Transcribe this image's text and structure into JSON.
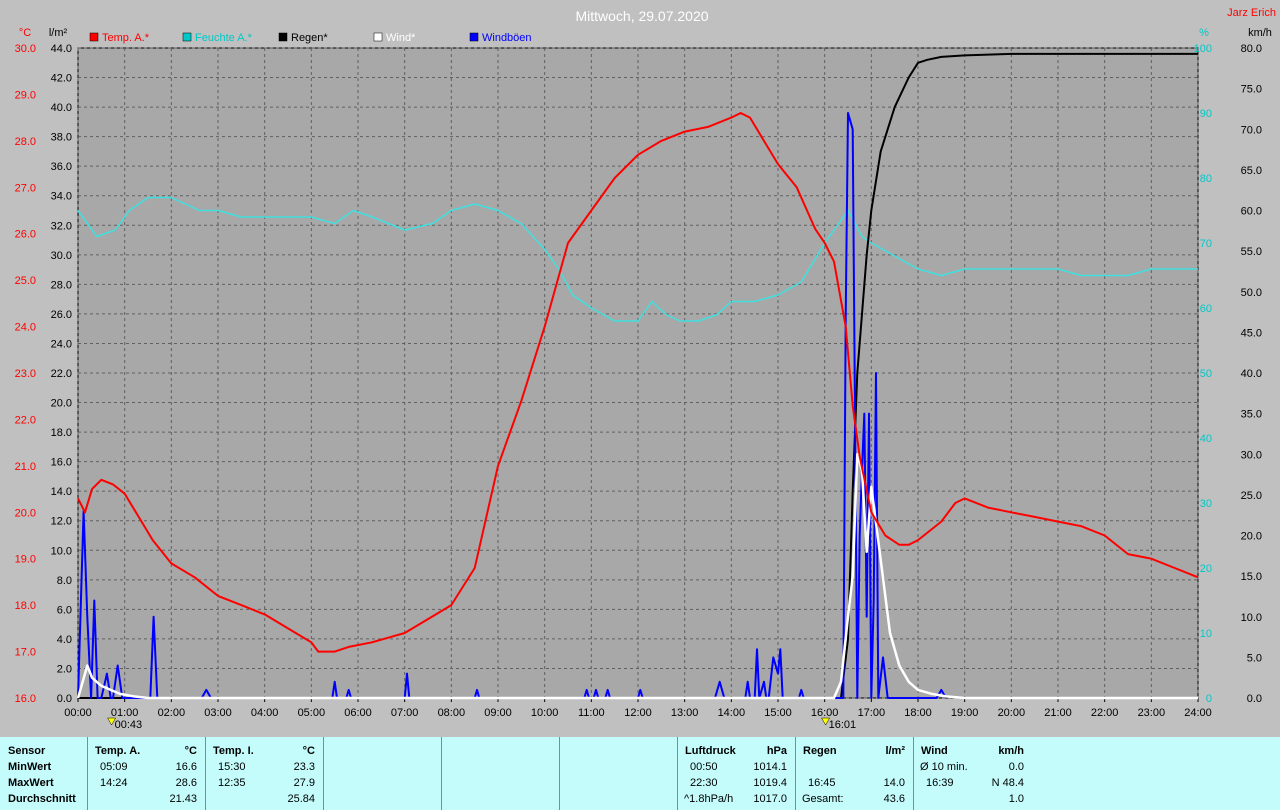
{
  "title": "Mittwoch, 29.07.2020",
  "author": "Jarz Erich",
  "chart_data": {
    "type": "line",
    "title": "Mittwoch, 29.07.2020",
    "legend": [
      {
        "name": "Temp. A.*",
        "color": "#ff0000"
      },
      {
        "name": "Feuchte A.*",
        "color": "#00c8c8"
      },
      {
        "name": "Regen*",
        "color": "#000000"
      },
      {
        "name": "Wind*",
        "color": "#ffffff"
      },
      {
        "name": "Windböen",
        "color": "#0000ff"
      }
    ],
    "colors": {
      "temp": "#ff0000",
      "humidity": "#40e0e0",
      "rain": "#000000",
      "wind": "#ffffff",
      "gust": "#0000ff"
    },
    "x_ticks": [
      "00:00",
      "01:00",
      "02:00",
      "03:00",
      "04:00",
      "05:00",
      "06:00",
      "07:00",
      "08:00",
      "09:00",
      "10:00",
      "11:00",
      "12:00",
      "13:00",
      "14:00",
      "15:00",
      "16:00",
      "17:00",
      "18:00",
      "19:00",
      "20:00",
      "21:00",
      "22:00",
      "23:00",
      "24:00"
    ],
    "x_range": [
      0,
      24
    ],
    "markers": [
      {
        "x": 0.72,
        "label": "00:43"
      },
      {
        "x": 16.02,
        "label": "16:01"
      }
    ],
    "axes": {
      "temp": {
        "unit": "°C",
        "range": [
          16,
          30
        ],
        "ticks": [
          "16.0",
          "17.0",
          "18.0",
          "19.0",
          "20.0",
          "21.0",
          "22.0",
          "23.0",
          "24.0",
          "25.0",
          "26.0",
          "27.0",
          "28.0",
          "29.0",
          "30.0"
        ],
        "color": "#ff0000"
      },
      "rain": {
        "unit": "l/m²",
        "range": [
          0,
          44
        ],
        "ticks": [
          "0.0",
          "2.0",
          "4.0",
          "6.0",
          "8.0",
          "10.0",
          "12.0",
          "14.0",
          "16.0",
          "18.0",
          "20.0",
          "22.0",
          "24.0",
          "26.0",
          "28.0",
          "30.0",
          "32.0",
          "34.0",
          "36.0",
          "38.0",
          "40.0",
          "42.0",
          "44.0"
        ],
        "color": "#000000"
      },
      "humidity": {
        "unit": "%",
        "range": [
          0,
          100
        ],
        "ticks": [
          "0",
          "10",
          "20",
          "30",
          "40",
          "50",
          "60",
          "70",
          "80",
          "90",
          "100"
        ],
        "color": "#00c8c8"
      },
      "wind": {
        "unit": "km/h",
        "range": [
          0,
          80
        ],
        "ticks": [
          "0.0",
          "5.0",
          "10.0",
          "15.0",
          "20.0",
          "25.0",
          "30.0",
          "35.0",
          "40.0",
          "45.0",
          "50.0",
          "55.0",
          "60.0",
          "65.0",
          "70.0",
          "75.0",
          "80.0"
        ],
        "color": "#000000"
      }
    },
    "series": [
      {
        "key": "temp",
        "axis": "temp",
        "name": "Temp. A.*",
        "x": [
          0,
          0.15,
          0.3,
          0.5,
          0.75,
          1.0,
          1.3,
          1.6,
          2.0,
          2.5,
          3.0,
          3.5,
          4.0,
          4.5,
          5.0,
          5.15,
          5.5,
          5.8,
          6.3,
          7.0,
          7.5,
          8.0,
          8.5,
          9.0,
          9.5,
          10.0,
          10.5,
          11.0,
          11.5,
          12.0,
          12.5,
          13.0,
          13.5,
          14.0,
          14.2,
          14.4,
          14.7,
          15.0,
          15.4,
          15.8,
          16.0,
          16.2,
          16.45,
          16.6,
          16.75,
          17.0,
          17.3,
          17.6,
          17.8,
          18.0,
          18.5,
          18.8,
          19.0,
          19.5,
          20.0,
          20.5,
          21.0,
          21.5,
          22.0,
          22.5,
          23.0,
          23.5,
          24.0
        ],
        "values": [
          20.3,
          20.0,
          20.5,
          20.7,
          20.6,
          20.4,
          19.9,
          19.4,
          18.9,
          18.6,
          18.2,
          18.0,
          17.8,
          17.5,
          17.2,
          17.0,
          17.0,
          17.1,
          17.2,
          17.4,
          17.7,
          18.0,
          18.8,
          21.0,
          22.4,
          24.0,
          25.8,
          26.5,
          27.2,
          27.7,
          28.0,
          28.2,
          28.3,
          28.5,
          28.6,
          28.5,
          28.0,
          27.5,
          27.0,
          26.1,
          25.8,
          25.4,
          24.0,
          22.3,
          21.2,
          20.0,
          19.5,
          19.3,
          19.3,
          19.4,
          19.8,
          20.2,
          20.3,
          20.1,
          20.0,
          19.9,
          19.8,
          19.7,
          19.5,
          19.1,
          19.0,
          18.8,
          18.6
        ]
      },
      {
        "key": "humidity",
        "axis": "humidity",
        "name": "Feuchte A.*",
        "x": [
          0,
          0.4,
          0.8,
          1.1,
          1.5,
          2.0,
          2.6,
          3.0,
          3.5,
          4.0,
          4.5,
          5.0,
          5.5,
          5.9,
          6.3,
          7.0,
          7.6,
          8.0,
          8.5,
          9.0,
          9.5,
          10.0,
          10.3,
          10.6,
          11.0,
          11.5,
          12.0,
          12.3,
          12.6,
          12.9,
          13.3,
          13.7,
          14.0,
          14.5,
          15.0,
          15.5,
          16.0,
          16.3,
          16.5,
          16.8,
          17.0,
          17.5,
          18.0,
          18.5,
          19.0,
          20.0,
          21.0,
          21.5,
          22.0,
          22.5,
          23.0,
          23.5,
          24.0
        ],
        "values": [
          75,
          71,
          72,
          75,
          77,
          77,
          75,
          75,
          74,
          74,
          74,
          74,
          73,
          75,
          74,
          72,
          73,
          75,
          76,
          75,
          73,
          69,
          66,
          62,
          60,
          58,
          58,
          61,
          59,
          58,
          58,
          59,
          61,
          61,
          62,
          64,
          70,
          73,
          75,
          71,
          70,
          68,
          66,
          65,
          66,
          66,
          66,
          65,
          65,
          65,
          66,
          66,
          66
        ]
      },
      {
        "key": "rain",
        "axis": "rain",
        "name": "Regen*",
        "x": [
          0,
          16.35,
          16.5,
          16.6,
          16.7,
          16.8,
          16.9,
          17.0,
          17.2,
          17.5,
          17.8,
          18.0,
          18.2,
          18.5,
          19.0,
          20.0,
          24.0
        ],
        "values": [
          0,
          0,
          4,
          14,
          22,
          26,
          30,
          33,
          37,
          40,
          42,
          43.0,
          43.2,
          43.4,
          43.5,
          43.6,
          43.6
        ]
      },
      {
        "key": "wind",
        "axis": "wind",
        "name": "Wind*",
        "x": [
          0,
          0.1,
          0.2,
          0.3,
          0.5,
          0.7,
          0.9,
          1.2,
          1.5,
          16.2,
          16.35,
          16.5,
          16.6,
          16.7,
          16.8,
          16.9,
          17.0,
          17.2,
          17.4,
          17.6,
          17.8,
          18.0,
          18.3,
          18.6,
          19.0,
          24.0
        ],
        "values": [
          0,
          2,
          4,
          2.5,
          1.5,
          1,
          0.5,
          0.2,
          0,
          0,
          2,
          10,
          15,
          30,
          28,
          18,
          26,
          17,
          8,
          4,
          2,
          1,
          0.5,
          0.2,
          0,
          0
        ]
      },
      {
        "key": "gust",
        "axis": "wind",
        "name": "Windböen",
        "x": [
          0,
          0.12,
          0.2,
          0.28,
          0.35,
          0.42,
          0.5,
          0.58,
          0.62,
          0.7,
          0.75,
          0.85,
          0.95,
          1.05,
          1.1,
          1.2,
          1.55,
          1.62,
          1.7,
          1.8,
          2.65,
          2.75,
          2.85,
          5.45,
          5.5,
          5.55,
          5.75,
          5.8,
          5.85,
          7.0,
          7.05,
          7.1,
          8.5,
          8.55,
          8.6,
          10.85,
          10.9,
          10.95,
          11.05,
          11.1,
          11.15,
          11.3,
          11.35,
          11.4,
          12.0,
          12.05,
          12.1,
          13.65,
          13.75,
          13.85,
          14.3,
          14.35,
          14.4,
          14.5,
          14.55,
          14.6,
          14.7,
          14.75,
          14.8,
          14.9,
          15.0,
          15.05,
          15.1,
          15.45,
          15.5,
          15.55,
          16.4,
          16.45,
          16.5,
          16.6,
          16.7,
          16.75,
          16.8,
          16.85,
          16.9,
          16.95,
          17.0,
          17.05,
          17.1,
          17.15,
          17.25,
          17.35,
          18.4,
          18.5,
          18.6
        ],
        "values": [
          0,
          23,
          10,
          0,
          12,
          0,
          0,
          2,
          3,
          0,
          0,
          4,
          0,
          0,
          0,
          0,
          0,
          10,
          0,
          0,
          0,
          1,
          0,
          0,
          2,
          0,
          0,
          1,
          0,
          0,
          3,
          0,
          0,
          1,
          0,
          0,
          1,
          0,
          0,
          1,
          0,
          0,
          1,
          0,
          0,
          1,
          0,
          0,
          2,
          0,
          0,
          2,
          0,
          0,
          6,
          0,
          2,
          0,
          0,
          5,
          3,
          6,
          0,
          0,
          1,
          0,
          0,
          47,
          72,
          70,
          0,
          20,
          28,
          35,
          10,
          35,
          0,
          12,
          40,
          0,
          5,
          0,
          0,
          1,
          0
        ]
      }
    ]
  },
  "stats": {
    "sensor_col": {
      "header": "Sensor",
      "rows": [
        "MinWert",
        "MaxWert",
        "Durchschnitt"
      ]
    },
    "temp_a": {
      "header": "Temp. A.",
      "unit": "°C",
      "min_time": "05:09",
      "min_val": "16.6",
      "max_time": "14:24",
      "max_val": "28.6",
      "avg": "21.43"
    },
    "temp_i": {
      "header": "Temp. I.",
      "unit": "°C",
      "min_time": "15:30",
      "min_val": "23.3",
      "max_time": "12:35",
      "max_val": "27.9",
      "avg": "25.84"
    },
    "pressure": {
      "header": "Luftdruck",
      "unit": "hPa",
      "min_time": "00:50",
      "min_val": "1014.1",
      "max_time": "22:30",
      "max_val": "1019.4",
      "avg_time": "^1.8hPa/h",
      "avg": "1017.0"
    },
    "rain": {
      "header": "Regen",
      "unit": "l/m²",
      "max_time": "16:45",
      "max_val": "14.0",
      "total_label": "Gesamt:",
      "total": "43.6"
    },
    "wind": {
      "header": "Wind",
      "unit": "km/h",
      "row1_label": "Ø 10 min.",
      "row1_val": "0.0",
      "row2_time": "16:39",
      "row2_val": "N 48.4",
      "row3_val": "1.0"
    }
  }
}
